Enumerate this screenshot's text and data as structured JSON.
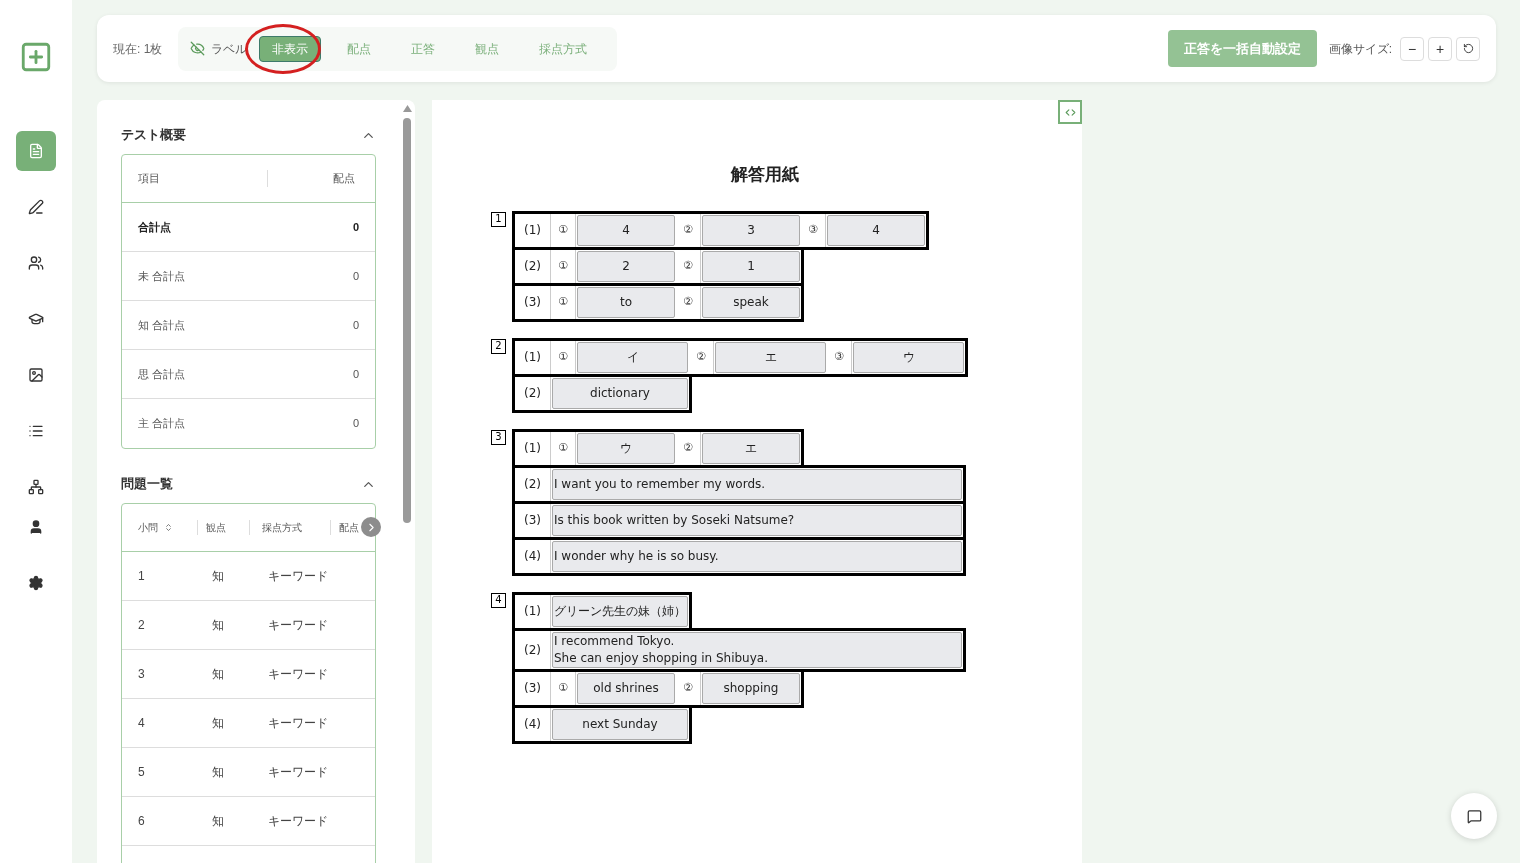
{
  "toolbar": {
    "current": "現在: 1枚",
    "label_toggle": {
      "label": "ラベル"
    },
    "modes": [
      {
        "label": "非表示",
        "selected": true,
        "highlighted": true
      },
      {
        "label": "配点",
        "selected": false,
        "highlighted": false
      },
      {
        "label": "正答",
        "selected": false,
        "highlighted": false
      },
      {
        "label": "観点",
        "selected": false,
        "highlighted": false
      },
      {
        "label": "採点方式",
        "selected": false,
        "highlighted": false
      }
    ],
    "auto_button": {
      "label": "正答を一括自動設定",
      "disabled": true
    },
    "image_size": {
      "label": "画像サイズ:",
      "buttons": [
        {
          "kind": "text",
          "text": "−"
        },
        {
          "kind": "text",
          "text": "+"
        },
        {
          "kind": "reset"
        }
      ]
    }
  },
  "sidebar": {
    "items": [
      {
        "kind": "file",
        "selected": true
      },
      {
        "kind": "pen",
        "selected": false
      },
      {
        "kind": "users",
        "selected": false
      },
      {
        "kind": "graduate",
        "selected": false
      },
      {
        "kind": "image",
        "selected": false
      },
      {
        "kind": "list",
        "selected": false
      },
      {
        "kind": "network",
        "selected": false
      },
      {
        "kind": "user",
        "selected": false
      },
      {
        "kind": "settings",
        "selected": false
      }
    ]
  },
  "summary": {
    "title": "テスト概要",
    "columns": [
      "項目",
      "配点"
    ],
    "rows": [
      {
        "item": "合計点",
        "points": "0",
        "bold": true
      },
      {
        "item": "未 合計点",
        "points": "0",
        "bold": false
      },
      {
        "item": "知 合計点",
        "points": "0",
        "bold": false
      },
      {
        "item": "思 合計点",
        "points": "0",
        "bold": false
      },
      {
        "item": "主 合計点",
        "points": "0",
        "bold": false
      }
    ]
  },
  "questions": {
    "title": "問題一覧",
    "columns": [
      "小問",
      "観点",
      "採点方式",
      "配点"
    ],
    "rows": [
      {
        "cells": [
          "1",
          "知",
          "キーワード"
        ]
      },
      {
        "cells": [
          "2",
          "知",
          "キーワード"
        ]
      },
      {
        "cells": [
          "3",
          "知",
          "キーワード"
        ]
      },
      {
        "cells": [
          "4",
          "知",
          "キーワード"
        ]
      },
      {
        "cells": [
          "5",
          "知",
          "キーワード"
        ]
      },
      {
        "cells": [
          "6",
          "知",
          "キーワード"
        ]
      }
    ]
  },
  "sheet": {
    "title": "解答用紙",
    "sections": [
      {
        "number": "1",
        "rows": [
          {
            "label": "(1)",
            "items": [
              {
                "kind": "num",
                "text": "①"
              },
              {
                "kind": "short",
                "text": "4"
              },
              {
                "kind": "num",
                "text": "②"
              },
              {
                "kind": "short",
                "text": "3"
              },
              {
                "kind": "num",
                "text": "③"
              },
              {
                "kind": "short",
                "text": "4"
              }
            ]
          },
          {
            "label": "(2)",
            "items": [
              {
                "kind": "num",
                "text": "①"
              },
              {
                "kind": "short",
                "text": "2"
              },
              {
                "kind": "num",
                "text": "②"
              },
              {
                "kind": "short",
                "text": "1"
              }
            ]
          },
          {
            "label": "(3)",
            "items": [
              {
                "kind": "num",
                "text": "①"
              },
              {
                "kind": "short",
                "text": "to"
              },
              {
                "kind": "num",
                "text": "②"
              },
              {
                "kind": "short",
                "text": "speak"
              }
            ]
          }
        ]
      },
      {
        "number": "2",
        "rows": [
          {
            "label": "(1)",
            "items": [
              {
                "kind": "num",
                "text": "①"
              },
              {
                "kind": "medium",
                "text": "イ"
              },
              {
                "kind": "num",
                "text": "②"
              },
              {
                "kind": "medium",
                "text": "エ"
              },
              {
                "kind": "num",
                "text": "③"
              },
              {
                "kind": "medium",
                "text": "ウ"
              }
            ]
          },
          {
            "label": "(2)",
            "items": [
              {
                "kind": "span",
                "text": "dictionary"
              }
            ]
          }
        ]
      },
      {
        "number": "3",
        "rows": [
          {
            "label": "(1)",
            "items": [
              {
                "kind": "num",
                "text": "①"
              },
              {
                "kind": "short",
                "text": "ウ"
              },
              {
                "kind": "num",
                "text": "②"
              },
              {
                "kind": "short",
                "text": "エ"
              }
            ]
          },
          {
            "label": "(2)",
            "items": [
              {
                "kind": "full",
                "text": "I want you to remember my words."
              }
            ]
          },
          {
            "label": "(3)",
            "items": [
              {
                "kind": "full",
                "text": "Is this book written by Soseki Natsume?"
              }
            ]
          },
          {
            "label": "(4)",
            "items": [
              {
                "kind": "full",
                "text": "I wonder why he is so busy."
              }
            ]
          }
        ]
      },
      {
        "number": "4",
        "rows": [
          {
            "label": "(1)",
            "items": [
              {
                "kind": "span",
                "text": "グリーン先生の妹（姉）"
              }
            ]
          },
          {
            "label": "(2)",
            "items": [
              {
                "kind": "full",
                "text": "I recommend Tokyo.\nShe can enjoy shopping in Shibuya."
              }
            ]
          },
          {
            "label": "(3)",
            "items": [
              {
                "kind": "num",
                "text": "①"
              },
              {
                "kind": "short",
                "text": "old shrines"
              },
              {
                "kind": "num",
                "text": "②"
              },
              {
                "kind": "short",
                "text": "shopping"
              }
            ]
          },
          {
            "label": "(4)",
            "items": [
              {
                "kind": "span",
                "text": "next Sunday"
              }
            ]
          }
        ]
      }
    ]
  }
}
